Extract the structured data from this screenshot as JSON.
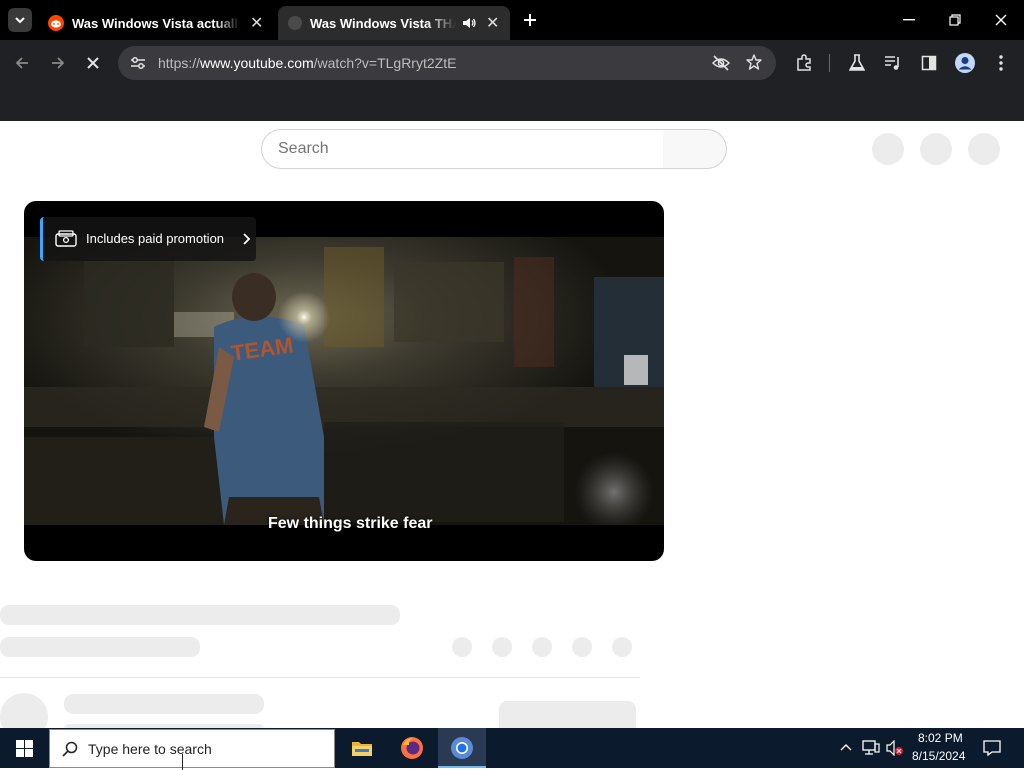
{
  "browser": {
    "tabs": [
      {
        "title": "Was Windows Vista actually bad",
        "active": false
      },
      {
        "title": "Was Windows Vista THAT bad",
        "active": true
      }
    ],
    "url_prefix": "https://",
    "url_domain": "www.youtube.com",
    "url_path": "/watch?v=TLgRryt2ZtE"
  },
  "youtube": {
    "search_placeholder": "Search",
    "paid_promotion_label": "Includes paid promotion",
    "caption": "Few things strike fear",
    "shirt_text": "TEAM"
  },
  "taskbar": {
    "search_placeholder": "Type here to search",
    "time": "8:02 PM",
    "date": "8/15/2024"
  },
  "colors": {
    "tabstrip_bg": "#000000",
    "toolbar_bg": "#202124",
    "taskbar_bg": "#0c1a2e",
    "accent_blue": "#3ea6ff"
  },
  "icons": {
    "tab_search": "chevron-down-icon",
    "reddit": "reddit-icon",
    "youtube_tab": "youtube-icon",
    "audio": "speaker-icon",
    "new_tab": "plus-icon"
  }
}
